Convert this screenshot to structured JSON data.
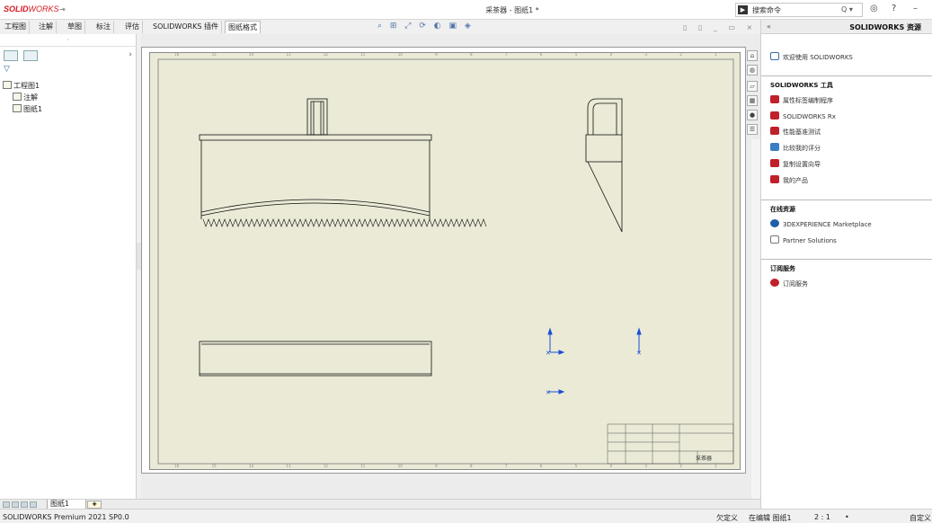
{
  "titlebar": {
    "logo_bold": "SOLID",
    "logo_light": "WORKS",
    "pin_glyph": "⇥",
    "document_title": "采茶器 - 图纸1 *",
    "search_placeholder": "搜索命令",
    "search_glyph": "Q ▾",
    "user_glyph": "◎",
    "help_glyph": "?",
    "min_glyph": "–"
  },
  "tabs": [
    {
      "label": "工程图"
    },
    {
      "label": "注解"
    },
    {
      "label": "草图"
    },
    {
      "label": "标注"
    },
    {
      "label": "评估"
    },
    {
      "label": "SOLIDWORKS 插件"
    },
    {
      "label": "图纸格式"
    }
  ],
  "view_tools": "⌕ ⊞ ⤢ ⟳ ◐ ▣ ◈",
  "win_ctrls": "▯ ▯ _ ▭ ×",
  "left_panel": {
    "collapse_glyph": "◦",
    "arrow_glyph": "›",
    "filter_glyph": "▽",
    "tree": [
      {
        "label": "工程图1"
      },
      {
        "label": "注解"
      },
      {
        "label": "图纸1"
      }
    ]
  },
  "ruler_labels": [
    "16",
    "15",
    "14",
    "13",
    "12",
    "11",
    "10",
    "9",
    "8",
    "7",
    "6",
    "5",
    "4",
    "3",
    "2",
    "1"
  ],
  "title_block_text": "采茶器",
  "right_panel": {
    "collapse_glyph": "«",
    "title": "SOLIDWORKS 资源",
    "welcome": "欢迎使用 SOLIDWORKS",
    "tools_section": "SOLIDWORKS 工具",
    "tools": [
      "属性标签编制程序",
      "SOLIDWORKS Rx",
      "性能基准测试",
      "比较我的评分",
      "复制设置向导",
      "我的产品"
    ],
    "online_section": "在线资源",
    "online": [
      "3DEXPERIENCE Marketplace",
      "Partner Solutions"
    ],
    "subscription_section": "订阅服务",
    "subscription": [
      "订阅服务"
    ]
  },
  "sheet_tabs": {
    "active": "图纸1",
    "add_glyph": "✚"
  },
  "status": {
    "product": "SOLIDWORKS Premium 2021 SP0.0",
    "state": "欠定义",
    "editing": "在编辑 图纸1",
    "scale": "2 : 1",
    "dot": "•",
    "custom": "自定义"
  },
  "colors": {
    "sheet_bg": "#eaead6",
    "accent_blue": "#1a4fd6",
    "brand_red": "#d71920"
  }
}
